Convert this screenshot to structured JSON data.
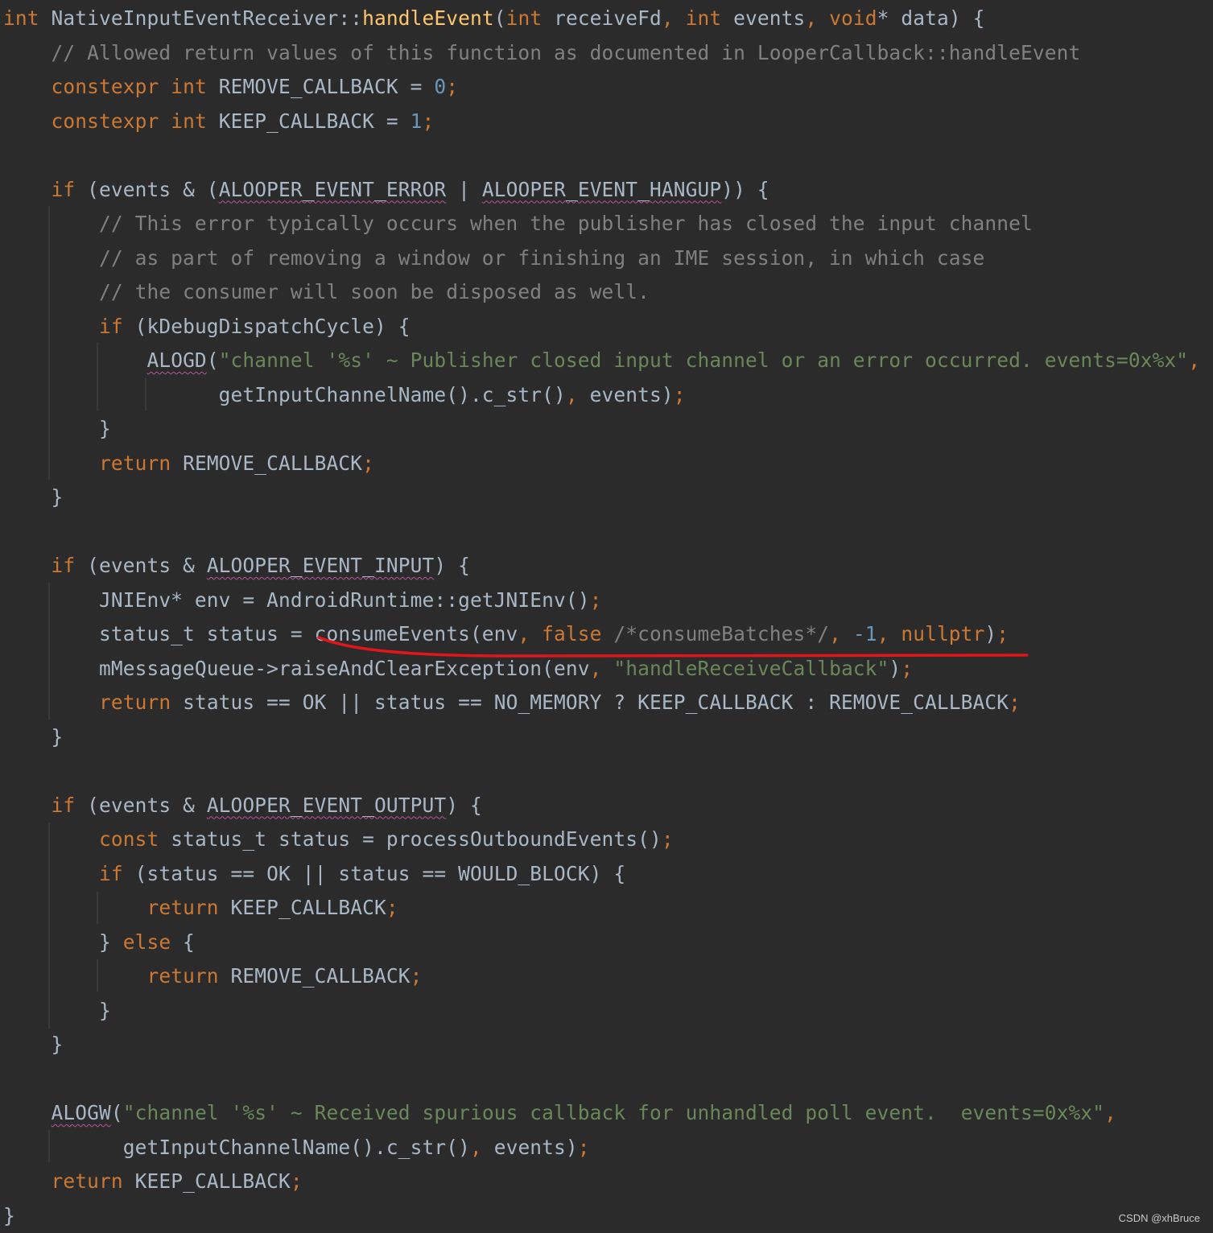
{
  "code_lines": [
    {
      "tokens": [
        {
          "t": "int",
          "c": "kw"
        },
        {
          "t": " NativeInputEventReceiver::",
          "c": "plain"
        },
        {
          "t": "handleEvent",
          "c": "fn"
        },
        {
          "t": "(",
          "c": "plain"
        },
        {
          "t": "int",
          "c": "kw"
        },
        {
          "t": " receiveFd",
          "c": "plain"
        },
        {
          "t": ",",
          "c": "kw"
        },
        {
          "t": " ",
          "c": "plain"
        },
        {
          "t": "int",
          "c": "kw"
        },
        {
          "t": " events",
          "c": "plain"
        },
        {
          "t": ",",
          "c": "kw"
        },
        {
          "t": " ",
          "c": "plain"
        },
        {
          "t": "void",
          "c": "kw"
        },
        {
          "t": "* data) {",
          "c": "plain"
        }
      ]
    },
    {
      "tokens": [
        {
          "t": "    // Allowed return values of this function as documented in LooperCallback::handleEvent",
          "c": "cm"
        }
      ]
    },
    {
      "tokens": [
        {
          "t": "    ",
          "c": "plain"
        },
        {
          "t": "constexpr",
          "c": "kw"
        },
        {
          "t": " ",
          "c": "plain"
        },
        {
          "t": "int",
          "c": "kw"
        },
        {
          "t": " REMOVE_CALLBACK = ",
          "c": "plain"
        },
        {
          "t": "0",
          "c": "num"
        },
        {
          "t": ";",
          "c": "kw"
        }
      ]
    },
    {
      "tokens": [
        {
          "t": "    ",
          "c": "plain"
        },
        {
          "t": "constexpr",
          "c": "kw"
        },
        {
          "t": " ",
          "c": "plain"
        },
        {
          "t": "int",
          "c": "kw"
        },
        {
          "t": " KEEP_CALLBACK = ",
          "c": "plain"
        },
        {
          "t": "1",
          "c": "num"
        },
        {
          "t": ";",
          "c": "kw"
        }
      ]
    },
    {
      "tokens": [
        {
          "t": "",
          "c": "plain"
        }
      ]
    },
    {
      "tokens": [
        {
          "t": "    ",
          "c": "plain"
        },
        {
          "t": "if",
          "c": "kw"
        },
        {
          "t": " (events & (",
          "c": "plain"
        },
        {
          "t": "ALOOPER_EVENT_ERROR",
          "c": "squig"
        },
        {
          "t": " | ",
          "c": "plain"
        },
        {
          "t": "ALOOPER_EVENT_HANGUP",
          "c": "squig"
        },
        {
          "t": ")) {",
          "c": "plain"
        }
      ]
    },
    {
      "tokens": [
        {
          "t": "        // This error typically occurs when the publisher has closed the input channel",
          "c": "cm"
        }
      ]
    },
    {
      "tokens": [
        {
          "t": "        // as part of removing a window or finishing an IME session, in which case",
          "c": "cm"
        }
      ]
    },
    {
      "tokens": [
        {
          "t": "        // the consumer will soon be disposed as well.",
          "c": "cm"
        }
      ]
    },
    {
      "tokens": [
        {
          "t": "        ",
          "c": "plain"
        },
        {
          "t": "if",
          "c": "kw"
        },
        {
          "t": " (kDebugDispatchCycle) {",
          "c": "plain"
        }
      ]
    },
    {
      "tokens": [
        {
          "t": "            ",
          "c": "plain"
        },
        {
          "t": "ALOGD",
          "c": "squig"
        },
        {
          "t": "(",
          "c": "plain"
        },
        {
          "t": "\"channel '%s' ~ Publisher closed input channel or an error occurred. events=0x%x\"",
          "c": "str"
        },
        {
          "t": ",",
          "c": "kw"
        }
      ]
    },
    {
      "tokens": [
        {
          "t": "                  getInputChannelName().c_str()",
          "c": "plain"
        },
        {
          "t": ",",
          "c": "kw"
        },
        {
          "t": " events)",
          "c": "plain"
        },
        {
          "t": ";",
          "c": "kw"
        }
      ]
    },
    {
      "tokens": [
        {
          "t": "        }",
          "c": "plain"
        }
      ]
    },
    {
      "tokens": [
        {
          "t": "        ",
          "c": "plain"
        },
        {
          "t": "return",
          "c": "kw"
        },
        {
          "t": " REMOVE_CALLBACK",
          "c": "plain"
        },
        {
          "t": ";",
          "c": "kw"
        }
      ]
    },
    {
      "tokens": [
        {
          "t": "    }",
          "c": "plain"
        }
      ]
    },
    {
      "tokens": [
        {
          "t": "",
          "c": "plain"
        }
      ]
    },
    {
      "tokens": [
        {
          "t": "    ",
          "c": "plain"
        },
        {
          "t": "if",
          "c": "kw"
        },
        {
          "t": " (events & ",
          "c": "plain"
        },
        {
          "t": "ALOOPER_EVENT_INPUT",
          "c": "squig"
        },
        {
          "t": ") {",
          "c": "plain"
        }
      ]
    },
    {
      "tokens": [
        {
          "t": "        JNIEnv* env = AndroidRuntime::getJNIEnv()",
          "c": "plain"
        },
        {
          "t": ";",
          "c": "kw"
        }
      ]
    },
    {
      "tokens": [
        {
          "t": "        status_t status = consumeEvents(env",
          "c": "plain"
        },
        {
          "t": ",",
          "c": "kw"
        },
        {
          "t": " ",
          "c": "plain"
        },
        {
          "t": "false",
          "c": "kw"
        },
        {
          "t": " /*consumeBatches*/",
          "c": "cm"
        },
        {
          "t": ",",
          "c": "kw"
        },
        {
          "t": " ",
          "c": "plain"
        },
        {
          "t": "-1",
          "c": "num"
        },
        {
          "t": ",",
          "c": "kw"
        },
        {
          "t": " ",
          "c": "plain"
        },
        {
          "t": "nullptr",
          "c": "kw"
        },
        {
          "t": ")",
          "c": "plain"
        },
        {
          "t": ";",
          "c": "kw"
        }
      ]
    },
    {
      "tokens": [
        {
          "t": "        mMessageQueue->raiseAndClearException(env",
          "c": "plain"
        },
        {
          "t": ",",
          "c": "kw"
        },
        {
          "t": " ",
          "c": "plain"
        },
        {
          "t": "\"handleReceiveCallback\"",
          "c": "str"
        },
        {
          "t": ")",
          "c": "plain"
        },
        {
          "t": ";",
          "c": "kw"
        }
      ]
    },
    {
      "tokens": [
        {
          "t": "        ",
          "c": "plain"
        },
        {
          "t": "return",
          "c": "kw"
        },
        {
          "t": " status == OK || status == NO_MEMORY ? KEEP_CALLBACK : REMOVE_CALLBACK",
          "c": "plain"
        },
        {
          "t": ";",
          "c": "kw"
        }
      ]
    },
    {
      "tokens": [
        {
          "t": "    }",
          "c": "plain"
        }
      ]
    },
    {
      "tokens": [
        {
          "t": "",
          "c": "plain"
        }
      ]
    },
    {
      "tokens": [
        {
          "t": "    ",
          "c": "plain"
        },
        {
          "t": "if",
          "c": "kw"
        },
        {
          "t": " (events & ",
          "c": "plain"
        },
        {
          "t": "ALOOPER_EVENT_OUTPUT",
          "c": "squig"
        },
        {
          "t": ") {",
          "c": "plain"
        }
      ]
    },
    {
      "tokens": [
        {
          "t": "        ",
          "c": "plain"
        },
        {
          "t": "const",
          "c": "kw"
        },
        {
          "t": " status_t status = processOutboundEvents()",
          "c": "plain"
        },
        {
          "t": ";",
          "c": "kw"
        }
      ]
    },
    {
      "tokens": [
        {
          "t": "        ",
          "c": "plain"
        },
        {
          "t": "if",
          "c": "kw"
        },
        {
          "t": " (status == OK || status == WOULD_BLOCK) {",
          "c": "plain"
        }
      ]
    },
    {
      "tokens": [
        {
          "t": "            ",
          "c": "plain"
        },
        {
          "t": "return",
          "c": "kw"
        },
        {
          "t": " KEEP_CALLBACK",
          "c": "plain"
        },
        {
          "t": ";",
          "c": "kw"
        }
      ]
    },
    {
      "tokens": [
        {
          "t": "        } ",
          "c": "plain"
        },
        {
          "t": "else",
          "c": "kw"
        },
        {
          "t": " {",
          "c": "plain"
        }
      ]
    },
    {
      "tokens": [
        {
          "t": "            ",
          "c": "plain"
        },
        {
          "t": "return",
          "c": "kw"
        },
        {
          "t": " REMOVE_CALLBACK",
          "c": "plain"
        },
        {
          "t": ";",
          "c": "kw"
        }
      ]
    },
    {
      "tokens": [
        {
          "t": "        }",
          "c": "plain"
        }
      ]
    },
    {
      "tokens": [
        {
          "t": "    }",
          "c": "plain"
        }
      ]
    },
    {
      "tokens": [
        {
          "t": "",
          "c": "plain"
        }
      ]
    },
    {
      "tokens": [
        {
          "t": "    ",
          "c": "plain"
        },
        {
          "t": "ALOGW",
          "c": "squig"
        },
        {
          "t": "(",
          "c": "plain"
        },
        {
          "t": "\"channel '%s' ~ Received spurious callback for unhandled poll event.  events=0x%x\"",
          "c": "str"
        },
        {
          "t": ",",
          "c": "kw"
        }
      ]
    },
    {
      "tokens": [
        {
          "t": "          getInputChannelName().c_str()",
          "c": "plain"
        },
        {
          "t": ",",
          "c": "kw"
        },
        {
          "t": " events)",
          "c": "plain"
        },
        {
          "t": ";",
          "c": "kw"
        }
      ]
    },
    {
      "tokens": [
        {
          "t": "    ",
          "c": "plain"
        },
        {
          "t": "return",
          "c": "kw"
        },
        {
          "t": " KEEP_CALLBACK",
          "c": "plain"
        },
        {
          "t": ";",
          "c": "kw"
        }
      ]
    },
    {
      "tokens": [
        {
          "t": "}",
          "c": "plain"
        }
      ]
    }
  ],
  "colors": {
    "background": "#2b2b2b",
    "keyword": "#cc7832",
    "function": "#ffc66d",
    "number": "#6897bb",
    "string": "#6a8759",
    "comment": "#808080",
    "text": "#a9b7c6",
    "annotation": "#e0161b"
  },
  "watermark": "CSDN @xhBruce"
}
